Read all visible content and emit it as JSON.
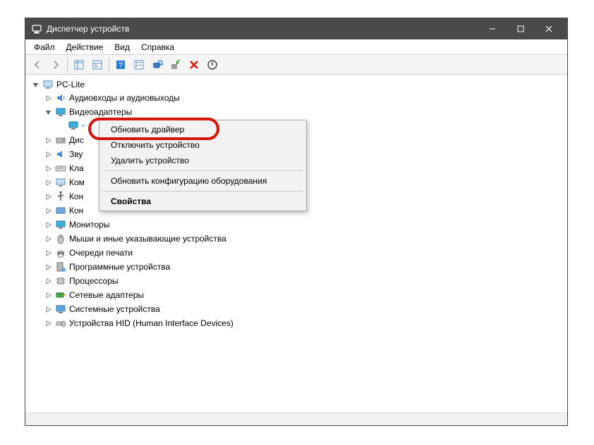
{
  "window": {
    "title": "Диспетчер устройств"
  },
  "menu": {
    "file": "Файл",
    "action": "Действие",
    "view": "Вид",
    "help": "Справка"
  },
  "tree": {
    "root": "PC-Lite",
    "audio": "Аудиовходы и аудиовыходы",
    "video": "Видеоадаптеры",
    "video_device": " ",
    "disk": "Дис",
    "sound": "Зву",
    "keyboard": "Кла",
    "computer": "Ком",
    "controllers1": "Кон",
    "controllers2": "Кон",
    "monitors": "Мониторы",
    "mice": "Мыши и иные указывающие устройства",
    "print": "Очереди печати",
    "software": "Программные устройства",
    "cpu": "Процессоры",
    "network": "Сетевые адаптеры",
    "system": "Системные устройства",
    "hid": "Устройства HID (Human Interface Devices)"
  },
  "context_menu": {
    "update_driver": "Обновить драйвер",
    "disable": "Отключить устройство",
    "uninstall": "Удалить устройство",
    "scan": "Обновить конфигурацию оборудования",
    "properties": "Свойства"
  }
}
